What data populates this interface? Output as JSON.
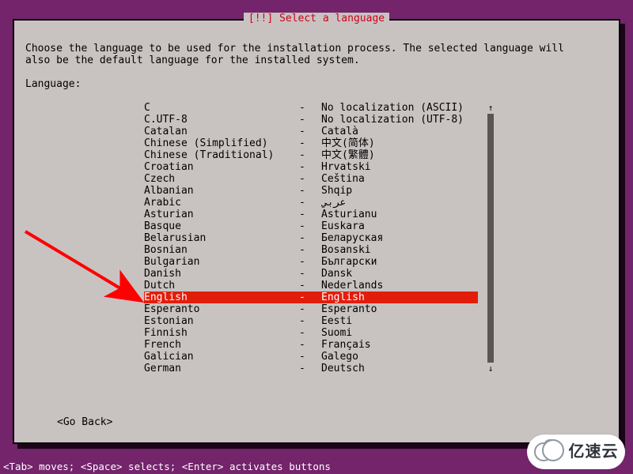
{
  "dialog": {
    "title": "[!!] Select a language",
    "instructions": "Choose the language to be used for the installation process. The selected language will\nalso be the default language for the installed system.",
    "label": "Language:",
    "go_back": "<Go Back>"
  },
  "scroll": {
    "up_glyph": "↑",
    "down_glyph": "↓"
  },
  "languages": [
    {
      "name": "C",
      "sep": "-",
      "native": "No localization (ASCII)",
      "selected": false
    },
    {
      "name": "C.UTF-8",
      "sep": "-",
      "native": "No localization (UTF-8)",
      "selected": false
    },
    {
      "name": "Catalan",
      "sep": "-",
      "native": "Català",
      "selected": false
    },
    {
      "name": "Chinese (Simplified)",
      "sep": "-",
      "native": "中文(简体)",
      "selected": false
    },
    {
      "name": "Chinese (Traditional)",
      "sep": "-",
      "native": "中文(繁體)",
      "selected": false
    },
    {
      "name": "Croatian",
      "sep": "-",
      "native": "Hrvatski",
      "selected": false
    },
    {
      "name": "Czech",
      "sep": "-",
      "native": "Čeština",
      "selected": false
    },
    {
      "name": "Albanian",
      "sep": "-",
      "native": "Shqip",
      "selected": false
    },
    {
      "name": "Arabic",
      "sep": "-",
      "native": "عربي",
      "selected": false
    },
    {
      "name": "Asturian",
      "sep": "-",
      "native": "Asturianu",
      "selected": false
    },
    {
      "name": "Basque",
      "sep": "-",
      "native": "Euskara",
      "selected": false
    },
    {
      "name": "Belarusian",
      "sep": "-",
      "native": "Беларуская",
      "selected": false
    },
    {
      "name": "Bosnian",
      "sep": "-",
      "native": "Bosanski",
      "selected": false
    },
    {
      "name": "Bulgarian",
      "sep": "-",
      "native": "Български",
      "selected": false
    },
    {
      "name": "Danish",
      "sep": "-",
      "native": "Dansk",
      "selected": false
    },
    {
      "name": "Dutch",
      "sep": "-",
      "native": "Nederlands",
      "selected": false
    },
    {
      "name": "English",
      "sep": "-",
      "native": "English",
      "selected": true
    },
    {
      "name": "Esperanto",
      "sep": "-",
      "native": "Esperanto",
      "selected": false
    },
    {
      "name": "Estonian",
      "sep": "-",
      "native": "Eesti",
      "selected": false
    },
    {
      "name": "Finnish",
      "sep": "-",
      "native": "Suomi",
      "selected": false
    },
    {
      "name": "French",
      "sep": "-",
      "native": "Français",
      "selected": false
    },
    {
      "name": "Galician",
      "sep": "-",
      "native": "Galego",
      "selected": false
    },
    {
      "name": "German",
      "sep": "-",
      "native": "Deutsch",
      "selected": false
    }
  ],
  "footer": "<Tab> moves; <Space> selects; <Enter> activates buttons",
  "logo_text": "亿速云"
}
